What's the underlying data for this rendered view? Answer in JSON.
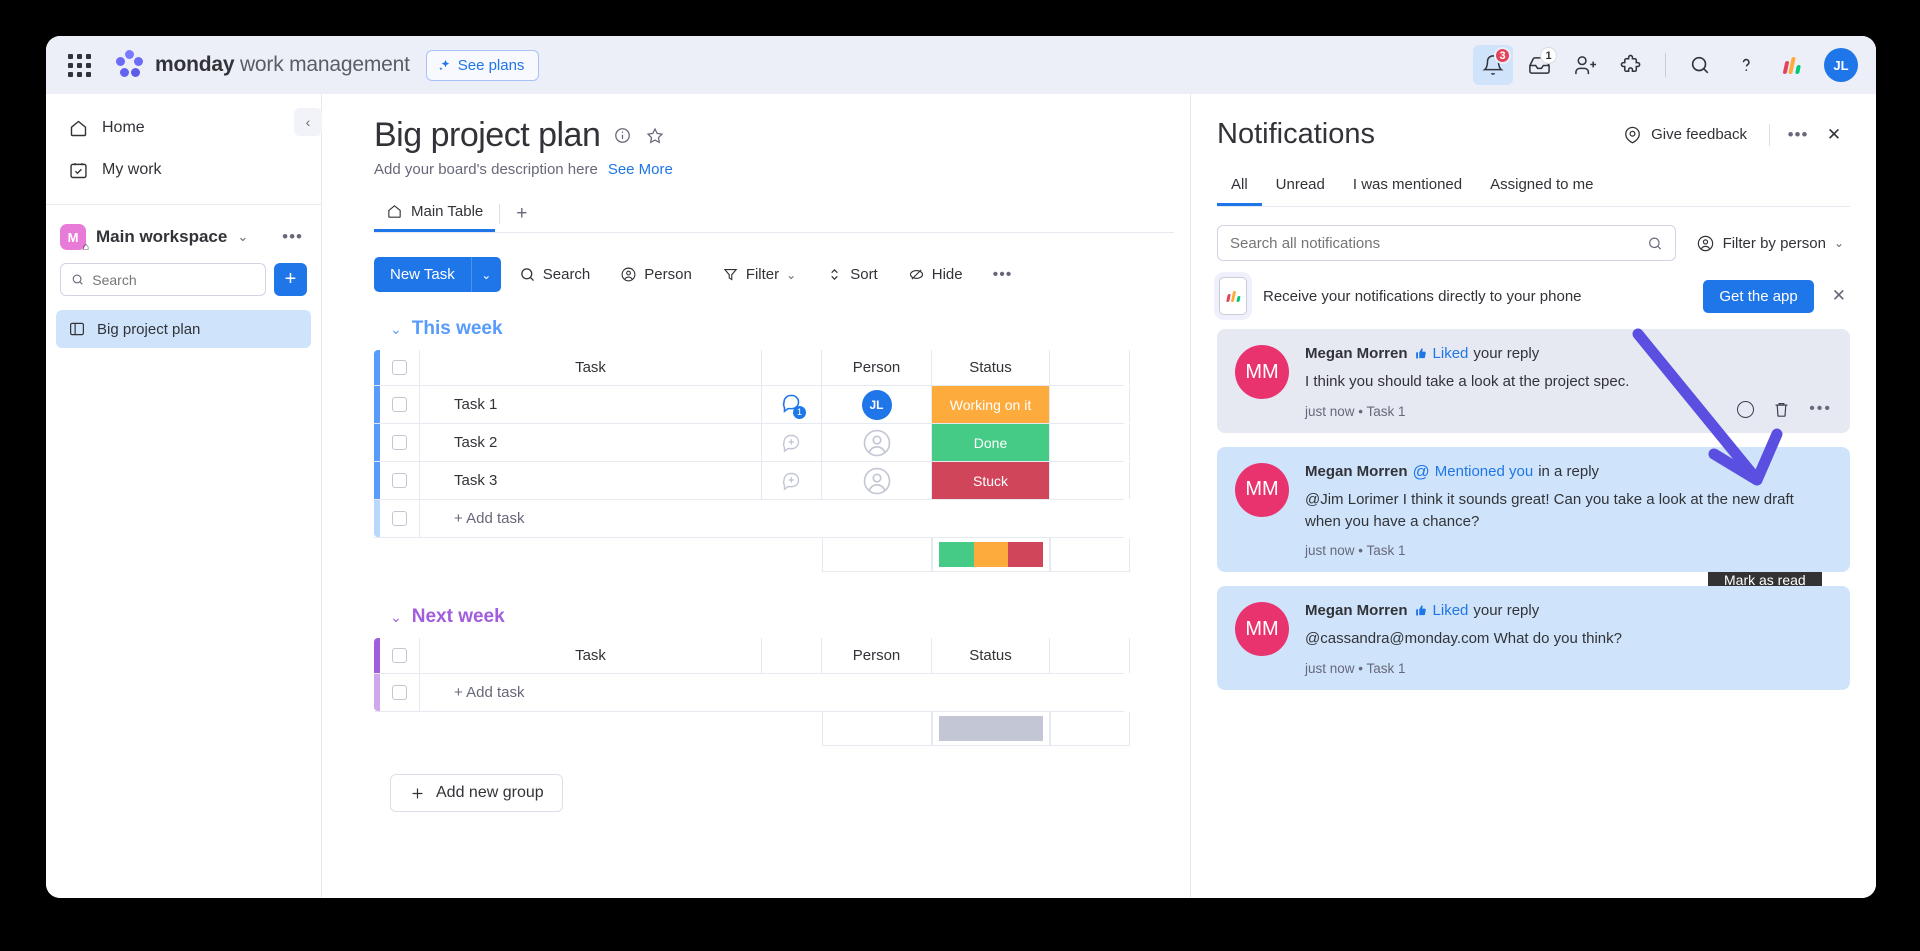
{
  "topbar": {
    "brand_bold": "monday",
    "brand_light": " work management",
    "see_plans": "See plans",
    "notifications_badge": "3",
    "inbox_badge": "1",
    "avatar_initials": "JL"
  },
  "sidebar": {
    "nav": [
      {
        "label": "Home",
        "icon": "home-icon"
      },
      {
        "label": "My work",
        "icon": "calendar-check-icon"
      }
    ],
    "workspace": {
      "initial": "M",
      "name": "Main workspace"
    },
    "search_placeholder": "Search",
    "add_label": "+",
    "boards": [
      {
        "label": "Big project plan",
        "icon": "board-icon"
      }
    ]
  },
  "board": {
    "title": "Big project plan",
    "description": "Add your board's description here",
    "see_more": "See More",
    "tabs": [
      {
        "label": "Main Table"
      }
    ],
    "add_tab": "+",
    "toolbar": {
      "new_task": "New Task",
      "search": "Search",
      "person": "Person",
      "filter": "Filter",
      "sort": "Sort",
      "hide": "Hide",
      "more": "•••"
    },
    "columns": {
      "task": "Task",
      "person": "Person",
      "status": "Status"
    },
    "add_task_label": "+ Add task",
    "add_group_label": "Add new group",
    "groups": [
      {
        "name": "This week",
        "color": "#579bfc",
        "rows": [
          {
            "task": "Task 1",
            "updates": "1",
            "person": "JL",
            "status": "Working on it",
            "status_color": "#fdab3d"
          },
          {
            "task": "Task 2",
            "updates": "",
            "person": "",
            "status": "Done",
            "status_color": "#45cb85"
          },
          {
            "task": "Task 3",
            "updates": "",
            "person": "",
            "status": "Stuck",
            "status_color": "#d0455a"
          }
        ],
        "summary": [
          {
            "color": "#45cb85",
            "pct": 33.4
          },
          {
            "color": "#fdab3d",
            "pct": 33.3
          },
          {
            "color": "#d0455a",
            "pct": 33.3
          }
        ]
      },
      {
        "name": "Next week",
        "color": "#a25ddc",
        "rows": [],
        "summary": [
          {
            "color": "#c3c6d4",
            "pct": 100
          }
        ]
      }
    ]
  },
  "notifications": {
    "title": "Notifications",
    "give_feedback": "Give feedback",
    "more": "•••",
    "close": "✕",
    "tabs": [
      {
        "label": "All",
        "active": true
      },
      {
        "label": "Unread",
        "active": false
      },
      {
        "label": "I was mentioned",
        "active": false
      },
      {
        "label": "Assigned to me",
        "active": false
      }
    ],
    "search_placeholder": "Search all notifications",
    "filter_by_person": "Filter by person",
    "promo": {
      "text": "Receive your notifications directly to your phone",
      "button": "Get the app"
    },
    "tooltip": "Mark as read",
    "items": [
      {
        "avatar": "MM",
        "actor": "Megan Morren",
        "action_icon": "thumbs-up-icon",
        "action_link": "Liked",
        "action_suffix": "your reply",
        "message": "I think you should take a look at the project spec.",
        "time": "just now",
        "separator": "•",
        "context": "Task 1",
        "state": "read"
      },
      {
        "avatar": "MM",
        "actor": "Megan Morren",
        "action_icon": "at-icon",
        "action_link": "Mentioned you",
        "action_suffix": "in a reply",
        "message": "@Jim Lorimer I think it sounds great! Can you take a look at the new draft when you have a chance?",
        "time": "just now",
        "separator": "•",
        "context": "Task 1",
        "state": "unread"
      },
      {
        "avatar": "MM",
        "actor": "Megan Morren",
        "action_icon": "thumbs-up-icon",
        "action_link": "Liked",
        "action_suffix": "your reply",
        "message": "@cassandra@monday.com What do you think?",
        "time": "just now",
        "separator": "•",
        "context": "Task 1",
        "state": "unread"
      }
    ]
  },
  "annotation": {
    "arrow_color": "#5a4fe0"
  }
}
